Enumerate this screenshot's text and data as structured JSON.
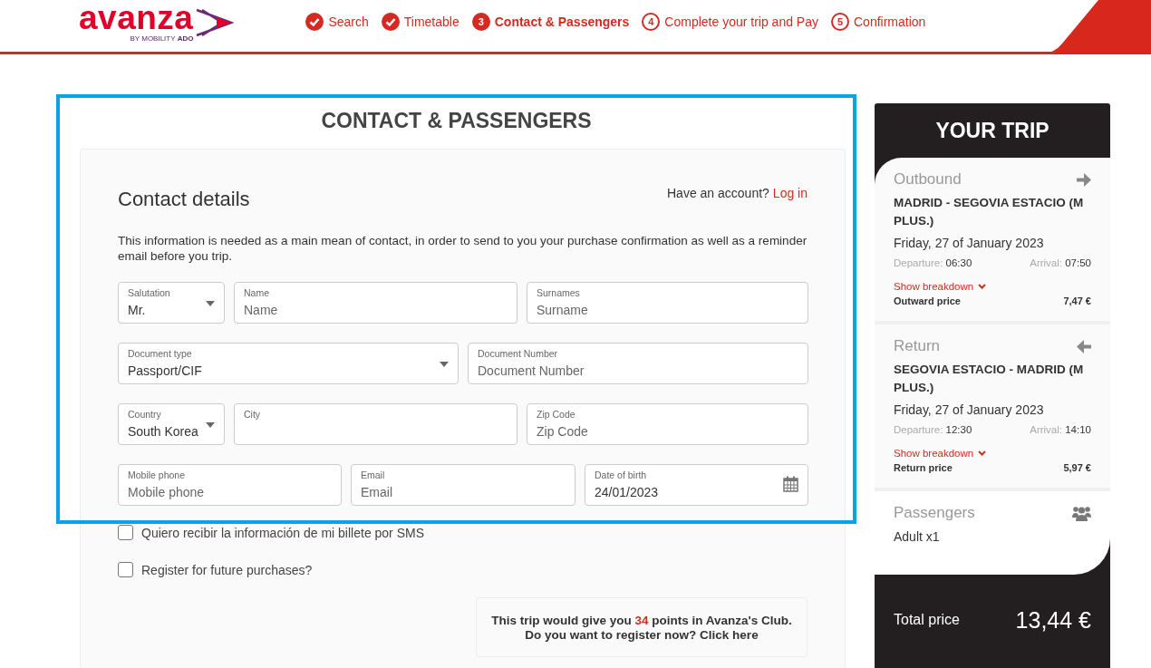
{
  "header": {
    "logo": {
      "word": "avanza",
      "byline": "BY MOBILITY **ADO**"
    },
    "steps": [
      {
        "label": "Search",
        "completed": true,
        "selected": false
      },
      {
        "label": "Timetable",
        "completed": true,
        "selected": false
      },
      {
        "number": "3",
        "label": "Contact & Passengers",
        "completed": false,
        "selected": true
      },
      {
        "number": "4",
        "label": "Complete your trip and Pay",
        "completed": false,
        "selected": false
      },
      {
        "number": "5",
        "label": "Confirmation",
        "completed": false,
        "selected": false
      }
    ]
  },
  "page_title": "CONTACT & PASSENGERS",
  "contact": {
    "title": "Contact details",
    "account_prompt": "Have an account?",
    "login_link": "Log in",
    "info": "This information is needed as a main mean of contact, in order to send to you your purchase confirmation as well as a reminder email before you trip.",
    "fields": [
      {
        "kind": "select",
        "label": "Salutation",
        "value": "Mr."
      },
      {
        "kind": "text",
        "label": "Name",
        "placeholder": "Name"
      },
      {
        "kind": "text",
        "label": "Surnames",
        "placeholder": "Surname"
      },
      {
        "kind": "select",
        "label": "Document type",
        "value": "Passport/CIF"
      },
      {
        "kind": "text",
        "label": "Document Number",
        "placeholder": "Document Number"
      },
      {
        "kind": "select",
        "label": "Country",
        "value": "South Korea"
      },
      {
        "kind": "text",
        "label": "City"
      },
      {
        "kind": "text",
        "label": "Zip Code",
        "placeholder": "Zip Code"
      },
      {
        "kind": "text",
        "label": "Mobile phone",
        "placeholder": "Mobile phone"
      },
      {
        "kind": "text",
        "label": "Email",
        "placeholder": "Email"
      },
      {
        "kind": "date",
        "label": "Date of birth",
        "value": "24/01/2023"
      }
    ],
    "checkboxes": [
      {
        "label": "Quiero recibir la información de mi billete por SMS",
        "checked": false
      },
      {
        "label": "Register for future purchases?",
        "checked": false
      }
    ],
    "club": {
      "before": "This trip would give you",
      "points": "34",
      "after": "points in Avanza's Club.",
      "line2": "Do you want to register now? Click here"
    }
  },
  "trip": {
    "title": "YOUR TRIP",
    "legs": [
      {
        "kind": "outbound",
        "heading": "Outbound",
        "route": "MADRID - SEGOVIA ESTACIO (M PLUS.)",
        "date": "Friday, 27 of January 2023",
        "departure_label": "Departure:",
        "departure": "06:30",
        "arrival_label": "Arrival:",
        "arrival": "07:50",
        "breakdown": "Show breakdown",
        "price_label": "Outward price",
        "price": "7,47 €"
      },
      {
        "kind": "return",
        "heading": "Return",
        "route": "SEGOVIA ESTACIO - MADRID (M PLUS.)",
        "date": "Friday, 27 of January 2023",
        "departure_label": "Departure:",
        "departure": "12:30",
        "arrival_label": "Arrival:",
        "arrival": "14:10",
        "breakdown": "Show breakdown",
        "price_label": "Return price",
        "price": "5,97 €"
      }
    ],
    "passengers": {
      "heading": "Passengers",
      "items": [
        "Adult x1"
      ]
    },
    "total": {
      "label": "Total price",
      "value": "13,44 €"
    }
  }
}
